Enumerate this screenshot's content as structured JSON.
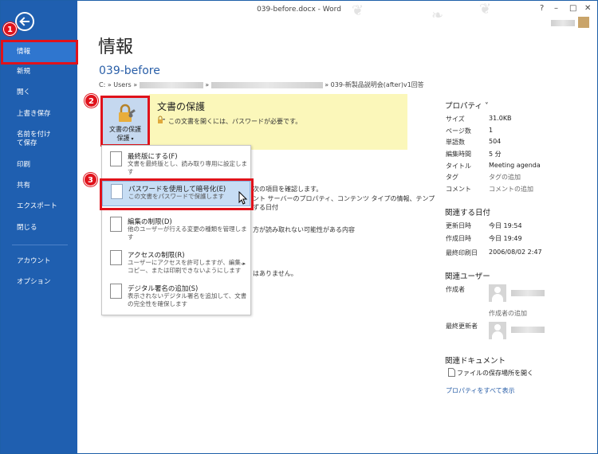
{
  "window": {
    "title": "039-before.docx - Word",
    "help": "?",
    "minimize": "–",
    "restore": "□",
    "close": "✕"
  },
  "sidebar": {
    "items": [
      {
        "label": "情報"
      },
      {
        "label": "新規"
      },
      {
        "label": "開く"
      },
      {
        "label": "上書き保存"
      },
      {
        "label": "名前を付けて保存"
      },
      {
        "label": "印刷"
      },
      {
        "label": "共有"
      },
      {
        "label": "エクスポート"
      },
      {
        "label": "閉じる"
      },
      {
        "label": "アカウント"
      },
      {
        "label": "オプション"
      }
    ]
  },
  "callouts": [
    "1",
    "2",
    "3"
  ],
  "main": {
    "title": "情報",
    "doc_name": "039-before",
    "path": {
      "start": "C: » Users »",
      "sep": "»",
      "end": "» 039-新製品説明会(after)v1回答"
    },
    "protect": {
      "button_label": "文書の保護",
      "button_label_2": "保護",
      "title": "文書の保護",
      "desc": "この文書を開くには、パスワードが必要です。"
    },
    "behind_text": [
      "次の項目を確認します。",
      "ント サーバーのプロパティ、コンテンツ タイプの情報、テンプ",
      "ずる日付",
      "方が読み取れない可能性がある内容",
      "はありません。"
    ]
  },
  "menu": {
    "items": [
      {
        "title": "最終版にする(F)",
        "desc": "文書を最終版とし、読み取り専用に設定します"
      },
      {
        "title": "パスワードを使用して暗号化(E)",
        "desc": "この文書をパスワードで保護します"
      },
      {
        "title": "編集の制限(D)",
        "desc": "他のユーザーが行える変更の種類を管理します"
      },
      {
        "title": "アクセスの制限(R)",
        "desc": "ユーザーにアクセスを許可しますが、編集、コピー、または印刷できないようにします",
        "submenu": "▸"
      },
      {
        "title": "デジタル署名の追加(S)",
        "desc": "表示されないデジタル署名を追加して、文書の完全性を確保します"
      }
    ]
  },
  "properties": {
    "header": "プロパティ ˅",
    "rows": [
      {
        "label": "サイズ",
        "value": "31.0KB"
      },
      {
        "label": "ページ数",
        "value": "1"
      },
      {
        "label": "単語数",
        "value": "504"
      },
      {
        "label": "編集時間",
        "value": "5 分"
      },
      {
        "label": "タイトル",
        "value": "Meeting agenda"
      },
      {
        "label": "タグ",
        "value": "タグの追加"
      },
      {
        "label": "コメント",
        "value": "コメントの追加"
      }
    ],
    "dates_header": "関連する日付",
    "dates": [
      {
        "label": "更新日時",
        "value": "今日 19:54"
      },
      {
        "label": "作成日時",
        "value": "今日 19:49"
      },
      {
        "label": "最終印刷日",
        "value": "2006/08/02 2:47"
      }
    ],
    "people_header": "関連ユーザー",
    "author_label": "作成者",
    "add_author": "作成者の追加",
    "last_modified_label": "最終更新者",
    "docs_header": "関連ドキュメント",
    "open_location": "ファイルの保存場所を開く",
    "show_all": "プロパティをすべて表示"
  }
}
